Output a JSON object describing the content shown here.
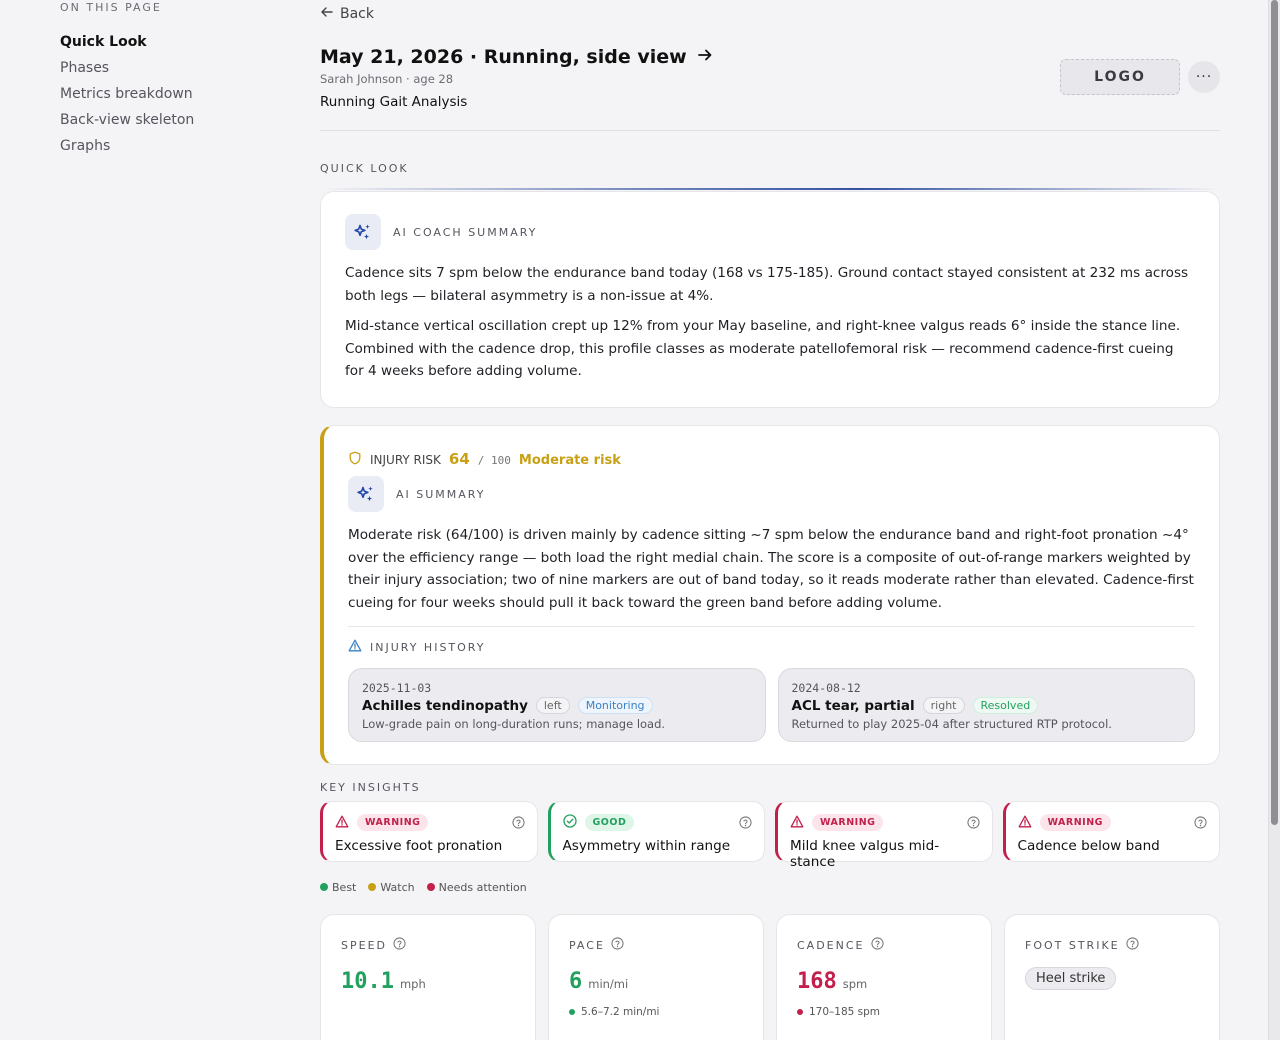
{
  "toc": {
    "heading": "ON THIS PAGE",
    "items": [
      {
        "label": "Quick Look",
        "active": true
      },
      {
        "label": "Phases",
        "active": false
      },
      {
        "label": "Metrics breakdown",
        "active": false
      },
      {
        "label": "Back-view skeleton",
        "active": false
      },
      {
        "label": "Graphs",
        "active": false
      }
    ]
  },
  "header": {
    "back_label": "Back",
    "title": "May 21, 2026 · Running, side view",
    "subject": "Sarah Johnson · age 28",
    "report_name": "Running Gait Analysis",
    "logo_text": "LOGO",
    "more_label": "···"
  },
  "quick_look": {
    "section_label": "QUICK LOOK",
    "coach": {
      "label": "AI COACH SUMMARY",
      "paragraphs": [
        "Cadence sits 7 spm below the endurance band today (168 vs 175-185). Ground contact stayed consistent at 232 ms across both legs — bilateral asymmetry is a non-issue at 4%.",
        "Mid-stance vertical oscillation crept up 12% from your May baseline, and right-knee valgus reads 6° inside the stance line. Combined with the cadence drop, this profile classes as moderate patellofemoral risk — recommend cadence-first cueing for 4 weeks before adding volume."
      ]
    }
  },
  "injury_risk": {
    "label": "INJURY RISK",
    "score": "64",
    "of": "/ 100",
    "level": "Moderate risk",
    "accent": "#c9a015",
    "ai_label": "AI SUMMARY",
    "summary": "Moderate risk (64/100) is driven mainly by cadence sitting ~7 spm below the endurance band and right-foot pronation ~4° over the efficiency range — both load the right medial chain. The score is a composite of out-of-range markers weighted by their injury association; two of nine markers are out of band today, so it reads moderate rather than elevated. Cadence-first cueing for four weeks should pull it back toward the green band before adding volume.",
    "history_label": "INJURY HISTORY",
    "history": [
      {
        "date": "2025-11-03",
        "title": "Achilles tendinopathy",
        "side": "left",
        "status": "Monitoring",
        "note": "Low-grade pain on long-duration runs; manage load."
      },
      {
        "date": "2024-08-12",
        "title": "ACL tear, partial",
        "side": "right",
        "status": "Resolved",
        "note": "Returned to play 2025-04 after structured RTP protocol."
      }
    ]
  },
  "key_insights": {
    "label": "KEY INSIGHTS",
    "items": [
      {
        "badge": "WARNING",
        "type": "warn",
        "title": "Excessive foot pronation"
      },
      {
        "badge": "GOOD",
        "type": "good",
        "title": "Asymmetry within range"
      },
      {
        "badge": "WARNING",
        "type": "warn",
        "title": "Mild knee valgus mid-stance"
      },
      {
        "badge": "WARNING",
        "type": "warn",
        "title": "Cadence below band"
      }
    ]
  },
  "legend": {
    "best": "Best",
    "watch": "Watch",
    "attention": "Needs attention",
    "colors": {
      "best": "#22a15e",
      "watch": "#c9a015",
      "attention": "#c21f4b"
    }
  },
  "metrics": [
    {
      "label": "SPEED",
      "value": "10.1",
      "unit": "mph",
      "range": "",
      "color": "#22a15e"
    },
    {
      "label": "PACE",
      "value": "6",
      "unit": "min/mi",
      "range": "5.6–7.2 min/mi",
      "color": "#22a15e"
    },
    {
      "label": "CADENCE",
      "value": "168",
      "unit": "spm",
      "range": "170–185 spm",
      "color": "#c21f4b"
    },
    {
      "label": "FOOT STRIKE",
      "chip": "Heel strike"
    }
  ]
}
